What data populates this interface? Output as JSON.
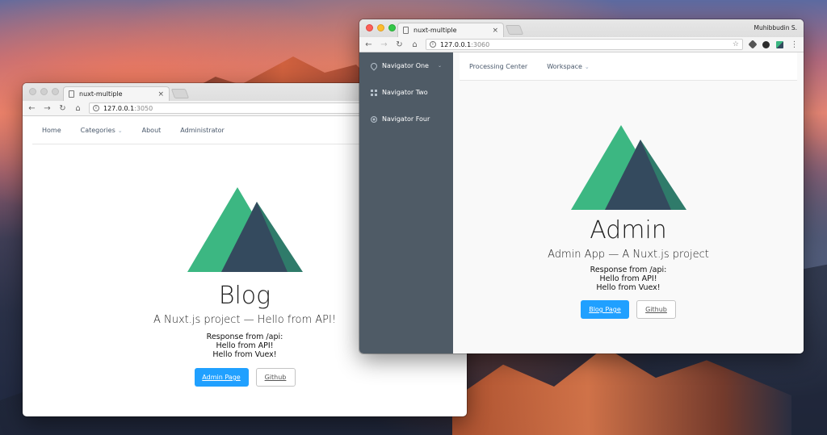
{
  "blog_window": {
    "tab_title": "nuxt-multiple",
    "close_glyph": "×",
    "url_host": "127.0.0.1",
    "url_port": ":3050",
    "nav": {
      "home": "Home",
      "categories": "Categories",
      "about": "About",
      "administrator": "Administrator"
    },
    "heading": "Blog",
    "subheading": "A Nuxt.js project — Hello from API!",
    "response_lines": [
      "Response from /api:",
      "Hello from API!",
      "Hello from Vuex!"
    ],
    "primary_button": "Admin Page",
    "secondary_button": "Github"
  },
  "admin_window": {
    "tab_title": "nuxt-multiple",
    "close_glyph": "×",
    "user": "Muhibbudin S.",
    "url_host": "127.0.0.1",
    "url_port": ":3060",
    "sidebar": {
      "items": [
        "Navigator One",
        "Navigator Two",
        "Navigator Four"
      ]
    },
    "nav": {
      "processing_center": "Processing Center",
      "workspace": "Workspace"
    },
    "heading": "Admin",
    "subheading": "Admin App — A Nuxt.js project",
    "response_lines": [
      "Response from /api:",
      "Hello from API!",
      "Hello from Vuex!"
    ],
    "primary_button": "Blog Page",
    "secondary_button": "Github"
  },
  "colors": {
    "nuxt_light_green": "#3cb782",
    "nuxt_dark_green": "#2f7b6a",
    "nuxt_navy": "#344a5e",
    "primary_blue": "#20a0ff",
    "sidebar_bg": "#4f5b66"
  },
  "icons": {
    "back": "←",
    "forward": "→",
    "reload": "↻",
    "home": "⌂",
    "bookmark": "☆",
    "chevron": "⌄",
    "menu": "⋮"
  }
}
